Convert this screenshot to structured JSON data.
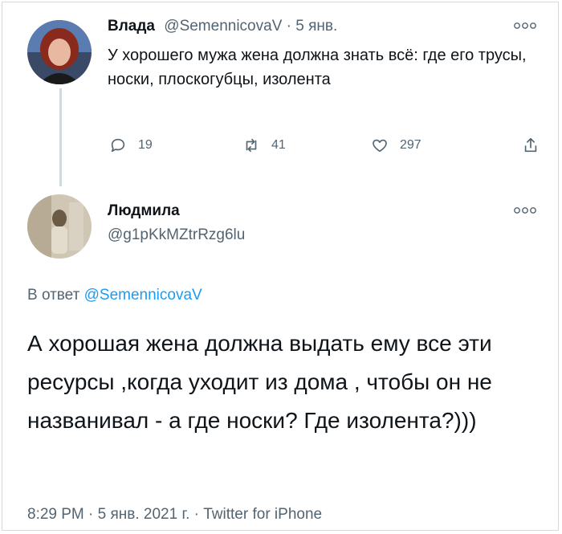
{
  "tweet1": {
    "author_name": "Влада",
    "author_handle": "@SemennicovaV",
    "separator": " · ",
    "date": "5 янв.",
    "more_icon": "more-horizontal-icon",
    "text": "У хорошего мужа жена должна знать всё: где его трусы, носки, плоскогубцы, изолента",
    "reply_count": "19",
    "retweet_count": "41",
    "like_count": "297"
  },
  "tweet2": {
    "author_name": "Людмила",
    "author_handle": "@g1pKkMZtrRzg6lu",
    "reply_prefix": "В ответ ",
    "reply_mention": "@SemennicovaV",
    "text": "А хорошая жена должна выдать ему все эти ресурсы ,когда уходит из дома , чтобы он не названивал - а где носки? Где изолента?)))",
    "meta": "8:29 PM · 5 янв. 2021 г. · Twitter for iPhone"
  },
  "colors": {
    "text": "#0f1419",
    "secondary": "#536471",
    "link": "#1d9bf0",
    "thread_line": "#cfd9de"
  }
}
